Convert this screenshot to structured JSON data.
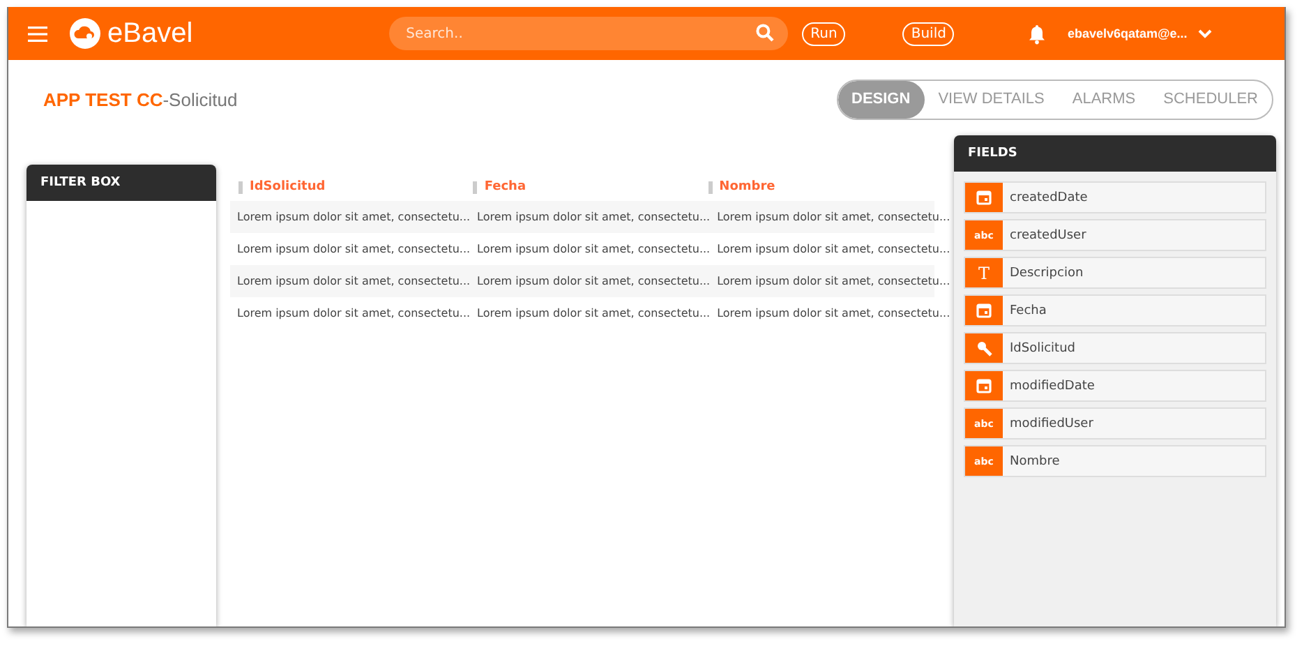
{
  "header": {
    "logo": "eBavel",
    "search": {
      "placeholder": "Search.."
    },
    "buttons": [
      "Run",
      "Build"
    ],
    "user": "ebavelv6qatam@e..."
  },
  "page_title": {
    "app": "APP TEST CC",
    "separator": "-",
    "form": "Solicitud"
  },
  "tabs": [
    {
      "label": "DESIGN",
      "selected": true
    },
    {
      "label": "VIEW DETAILS",
      "selected": false
    },
    {
      "label": "ALARMS",
      "selected": false
    },
    {
      "label": "SCHEDULER",
      "selected": false
    }
  ],
  "filter_box": {
    "title": "FILTER BOX"
  },
  "table": {
    "columns": [
      "IdSolicitud",
      "Fecha",
      "Nombre"
    ],
    "rows": [
      [
        "Lorem ipsum dolor sit amet, consectetu...",
        "Lorem ipsum dolor sit amet, consectetu...",
        "Lorem ipsum dolor sit amet, consectetu..."
      ],
      [
        "Lorem ipsum dolor sit amet, consectetu...",
        "Lorem ipsum dolor sit amet, consectetu...",
        "Lorem ipsum dolor sit amet, consectetu..."
      ],
      [
        "Lorem ipsum dolor sit amet, consectetu...",
        "Lorem ipsum dolor sit amet, consectetu...",
        "Lorem ipsum dolor sit amet, consectetu..."
      ],
      [
        "Lorem ipsum dolor sit amet, consectetu...",
        "Lorem ipsum dolor sit amet, consectetu...",
        "Lorem ipsum dolor sit amet, consectetu..."
      ]
    ]
  },
  "fields_panel": {
    "title": "FIELDS",
    "items": [
      {
        "name": "createdDate",
        "kind": "date"
      },
      {
        "name": "createdUser",
        "kind": "text",
        "icon_text": "abc"
      },
      {
        "name": "Descripcion",
        "kind": "longtext",
        "icon_text": "T"
      },
      {
        "name": "Fecha",
        "kind": "date"
      },
      {
        "name": "IdSolicitud",
        "kind": "key"
      },
      {
        "name": "modifiedDate",
        "kind": "date"
      },
      {
        "name": "modifiedUser",
        "kind": "text",
        "icon_text": "abc"
      },
      {
        "name": "Nombre",
        "kind": "text",
        "icon_text": "abc"
      }
    ]
  }
}
